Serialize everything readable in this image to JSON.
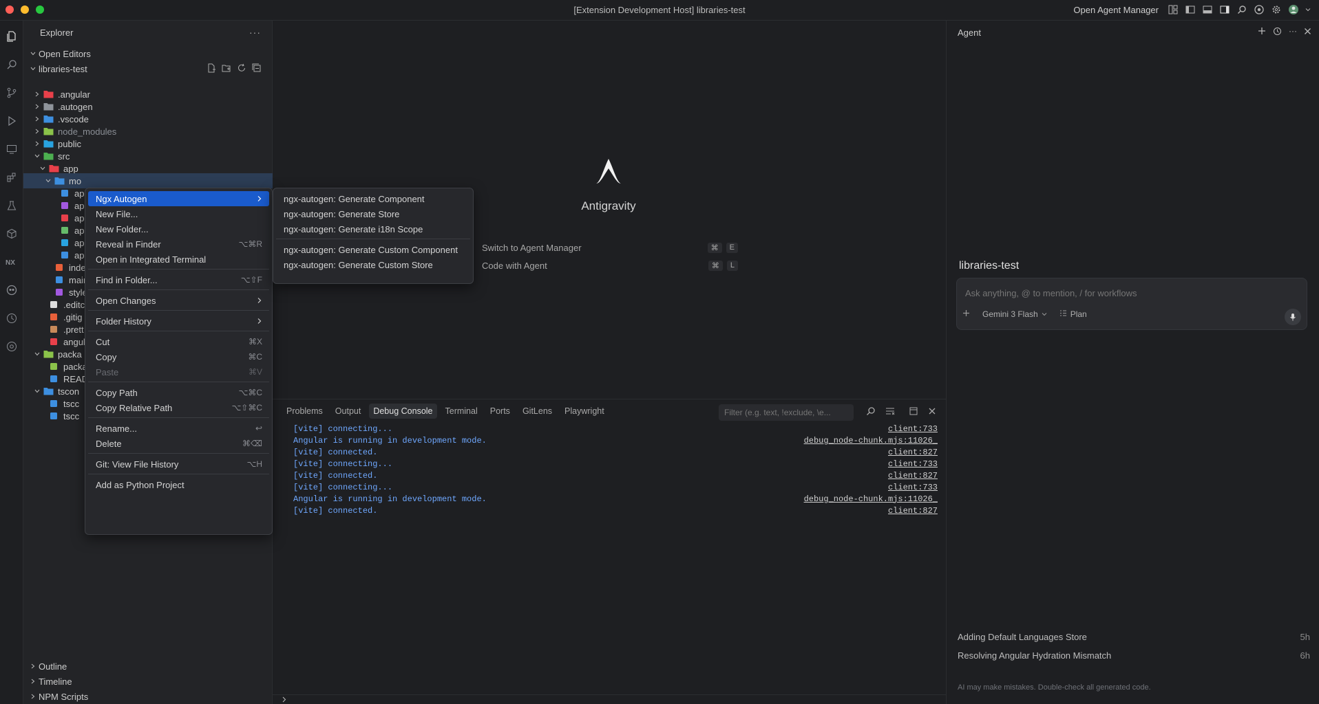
{
  "window": {
    "title": "[Extension Development Host] libraries-test",
    "open_agent_manager": "Open Agent Manager"
  },
  "explorer": {
    "title": "Explorer",
    "open_editors": "Open Editors",
    "root": "libraries-test",
    "tree": [
      {
        "label": ".angular",
        "depth": 1,
        "kind": "folder",
        "icon_color": "#e8404a"
      },
      {
        "label": ".autogen",
        "depth": 1,
        "kind": "folder",
        "icon_color": "#8f949b"
      },
      {
        "label": ".vscode",
        "depth": 1,
        "kind": "folder",
        "icon_color": "#3d8fe0"
      },
      {
        "label": "node_modules",
        "depth": 1,
        "kind": "folder",
        "icon_color": "#8bc34a",
        "muted": true
      },
      {
        "label": "public",
        "depth": 1,
        "kind": "folder",
        "icon_color": "#29a3e0"
      },
      {
        "label": "src",
        "depth": 1,
        "kind": "folder-open",
        "icon_color": "#4caf50"
      },
      {
        "label": "app",
        "depth": 2,
        "kind": "folder-open",
        "icon_color": "#e8404a"
      },
      {
        "label": "mo",
        "depth": 3,
        "kind": "folder-open",
        "icon_color": "#3d8fe0",
        "selected": true
      },
      {
        "label": "ap",
        "depth": 4,
        "kind": "file",
        "icon_color": "#3d8fe0"
      },
      {
        "label": "ap",
        "depth": 4,
        "kind": "file",
        "icon_color": "#a259e0"
      },
      {
        "label": "ap",
        "depth": 4,
        "kind": "file",
        "icon_color": "#e8404a"
      },
      {
        "label": "ap",
        "depth": 4,
        "kind": "file",
        "icon_color": "#66bb6a"
      },
      {
        "label": "ap",
        "depth": 4,
        "kind": "file",
        "icon_color": "#29a3e0"
      },
      {
        "label": "ap",
        "depth": 4,
        "kind": "file",
        "icon_color": "#3d8fe0"
      },
      {
        "label": "inde",
        "depth": 3,
        "kind": "file",
        "icon_color": "#e8603a"
      },
      {
        "label": "main",
        "depth": 3,
        "kind": "file",
        "icon_color": "#3d8fe0"
      },
      {
        "label": "style",
        "depth": 3,
        "kind": "file",
        "icon_color": "#a259e0"
      },
      {
        "label": ".editc",
        "depth": 2,
        "kind": "file",
        "icon_color": "#dddddd"
      },
      {
        "label": ".gitig",
        "depth": 2,
        "kind": "file",
        "icon_color": "#e8603a"
      },
      {
        "label": ".prett",
        "depth": 2,
        "kind": "file",
        "icon_color": "#c88a5a"
      },
      {
        "label": "angul",
        "depth": 2,
        "kind": "file",
        "icon_color": "#e8404a"
      },
      {
        "label": "packa",
        "depth": 1,
        "kind": "folder-open",
        "icon_color": "#8bc34a"
      },
      {
        "label": "packa",
        "depth": 2,
        "kind": "file",
        "icon_color": "#8bc34a"
      },
      {
        "label": "READ",
        "depth": 2,
        "kind": "file",
        "icon_color": "#3d8fe0"
      },
      {
        "label": "tscon",
        "depth": 1,
        "kind": "folder-open",
        "icon_color": "#3d8fe0"
      },
      {
        "label": "tscc",
        "depth": 2,
        "kind": "file",
        "icon_color": "#3d8fe0"
      },
      {
        "label": "tscc",
        "depth": 2,
        "kind": "file",
        "icon_color": "#3d8fe0"
      }
    ],
    "bottom_sections": [
      "Outline",
      "Timeline",
      "NPM Scripts"
    ]
  },
  "context_menu": {
    "items": [
      {
        "label": "Ngx Autogen",
        "shortcut": "",
        "submenu": true,
        "highlighted": true
      },
      {
        "label": "New File...",
        "shortcut": ""
      },
      {
        "label": "New Folder...",
        "shortcut": ""
      },
      {
        "label": "Reveal in Finder",
        "shortcut": "⌥⌘R"
      },
      {
        "label": "Open in Integrated Terminal",
        "shortcut": ""
      },
      {
        "separator": true
      },
      {
        "label": "Find in Folder...",
        "shortcut": "⌥⇧F"
      },
      {
        "separator": true
      },
      {
        "label": "Open Changes",
        "shortcut": "",
        "submenu": true
      },
      {
        "separator": true
      },
      {
        "label": "Folder History",
        "shortcut": "",
        "submenu": true
      },
      {
        "separator": true
      },
      {
        "label": "Cut",
        "shortcut": "⌘X"
      },
      {
        "label": "Copy",
        "shortcut": "⌘C"
      },
      {
        "label": "Paste",
        "shortcut": "⌘V",
        "disabled": true
      },
      {
        "separator": true
      },
      {
        "label": "Copy Path",
        "shortcut": "⌥⌘C"
      },
      {
        "label": "Copy Relative Path",
        "shortcut": "⌥⇧⌘C"
      },
      {
        "separator": true
      },
      {
        "label": "Rename...",
        "shortcut": "↩"
      },
      {
        "label": "Delete",
        "shortcut": "⌘⌫"
      },
      {
        "separator": true
      },
      {
        "label": "Git: View File History",
        "shortcut": "⌥H"
      },
      {
        "separator": true
      },
      {
        "label": "Add as Python Project",
        "shortcut": ""
      }
    ],
    "submenu": [
      {
        "label": "ngx-autogen: Generate Component"
      },
      {
        "label": "ngx-autogen: Generate Store"
      },
      {
        "label": "ngx-autogen: Generate i18n Scope"
      },
      {
        "separator": true
      },
      {
        "label": "ngx-autogen: Generate Custom Component"
      },
      {
        "label": "ngx-autogen: Generate Custom Store"
      }
    ]
  },
  "welcome": {
    "brand": "Antigravity",
    "shortcuts": [
      {
        "label": "Switch to Agent Manager",
        "keys": [
          "⌘",
          "E"
        ]
      },
      {
        "label": "Code with Agent",
        "keys": [
          "⌘",
          "L"
        ]
      }
    ]
  },
  "panel": {
    "tabs": [
      "Problems",
      "Output",
      "Debug Console",
      "Terminal",
      "Ports",
      "GitLens",
      "Playwright"
    ],
    "active_tab": "Debug Console",
    "filter_placeholder": "Filter (e.g. text, !exclude, \\e...",
    "console": [
      {
        "msg": "[vite] connecting...",
        "src": "client:733"
      },
      {
        "msg": "Angular is running in development mode.",
        "src": "debug_node-chunk.mjs:11026_"
      },
      {
        "msg": "[vite] connected.",
        "src": "client:827"
      },
      {
        "msg": "[vite] connecting...",
        "src": "client:733"
      },
      {
        "msg": "[vite] connected.",
        "src": "client:827"
      },
      {
        "msg": "[vite] connecting...",
        "src": "client:733"
      },
      {
        "msg": "Angular is running in development mode.",
        "src": "debug_node-chunk.mjs:11026_"
      },
      {
        "msg": "[vite] connected.",
        "src": "client:827"
      }
    ]
  },
  "agent": {
    "title": "Agent",
    "project": "libraries-test",
    "input_placeholder": "Ask anything, @ to mention, / for workflows",
    "model": "Gemini 3 Flash",
    "mode": "Plan",
    "history": [
      {
        "title": "Adding Default Languages Store",
        "age": "5h"
      },
      {
        "title": "Resolving Angular Hydration Mismatch",
        "age": "6h"
      }
    ],
    "disclaimer": "AI may make mistakes. Double-check all generated code."
  }
}
